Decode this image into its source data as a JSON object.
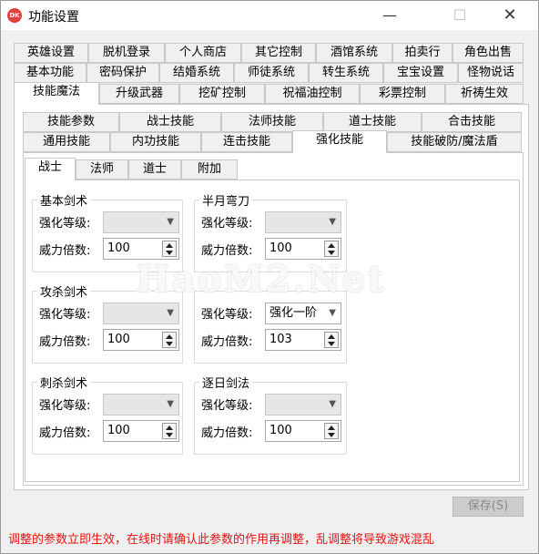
{
  "window": {
    "title": "功能设置",
    "icon_text": "DK",
    "minimize": "—",
    "maximize": "☐",
    "close": "✕"
  },
  "top_tabs": {
    "row1": [
      "英雄设置",
      "脱机登录",
      "个人商店",
      "其它控制",
      "酒馆系统",
      "拍卖行",
      "角色出售"
    ],
    "row2": [
      "基本功能",
      "密码保护",
      "结婚系统",
      "师徒系统",
      "转生系统",
      "宝宝设置",
      "怪物说话"
    ],
    "row3": [
      "技能魔法",
      "升级武器",
      "挖矿控制",
      "祝福油控制",
      "彩票控制",
      "祈祷生效"
    ],
    "active": "技能魔法"
  },
  "skill_tabs": {
    "row1": [
      "技能参数",
      "战士技能",
      "法师技能",
      "道士技能",
      "合击技能"
    ],
    "row2": [
      "通用技能",
      "内功技能",
      "连击技能",
      "强化技能",
      "技能破防/魔法盾"
    ],
    "active": "强化技能"
  },
  "class_tabs": {
    "items": [
      "战士",
      "法师",
      "道士",
      "附加"
    ],
    "active": "战士"
  },
  "groups": [
    {
      "title": "基本剑术",
      "level_label": "强化等级:",
      "level_value": "",
      "power_label": "威力倍数:",
      "power_value": "100"
    },
    {
      "title": "半月弯刀",
      "level_label": "强化等级:",
      "level_value": "",
      "power_label": "威力倍数:",
      "power_value": "100"
    },
    {
      "title": "攻杀剑术",
      "level_label": "强化等级:",
      "level_value": "",
      "power_label": "威力倍数:",
      "power_value": "100"
    },
    {
      "title": "",
      "level_label": "强化等级:",
      "level_value": "强化一阶",
      "power_label": "威力倍数:",
      "power_value": "103"
    },
    {
      "title": "刺杀剑术",
      "level_label": "强化等级:",
      "level_value": "",
      "power_label": "威力倍数:",
      "power_value": "100"
    },
    {
      "title": "逐日剑法",
      "level_label": "强化等级:",
      "level_value": "",
      "power_label": "威力倍数:",
      "power_value": "100"
    }
  ],
  "save_button": "保存(S)",
  "status_text": "调整的参数立即生效，在线时请确认此参数的作用再调整，乱调整将导致游戏混乱",
  "watermark": "HaoM2.Net",
  "colors": {
    "status": "#e01414",
    "close_icon_bg": "#e0403a"
  }
}
